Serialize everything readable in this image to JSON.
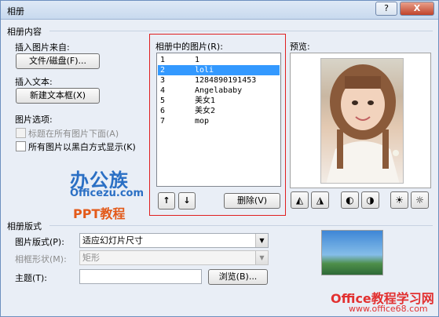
{
  "window": {
    "title": "相册",
    "help_label": "?",
    "close_label": "X"
  },
  "album_content": {
    "group_title": "相册内容",
    "insert_from_label": "插入图片来自:",
    "file_disk_button": "文件/磁盘(F)...",
    "insert_text_label": "插入文本:",
    "new_textbox_button": "新建文本框(X)",
    "picture_options_label": "图片选项:",
    "caption_below_option": "标题在所有图片下面(A)",
    "black_white_option": "所有图片以黑白方式显示(K)"
  },
  "picture_list": {
    "label": "相册中的图片(R):",
    "items": [
      {
        "num": "1",
        "name": "1"
      },
      {
        "num": "2",
        "name": "loli",
        "selected": true
      },
      {
        "num": "3",
        "name": "1284890191453"
      },
      {
        "num": "4",
        "name": "Angelababy"
      },
      {
        "num": "5",
        "name": "美女1"
      },
      {
        "num": "6",
        "name": "美女2"
      },
      {
        "num": "7",
        "name": "mop"
      }
    ],
    "move_up_label": "↑",
    "move_down_label": "↓",
    "delete_button": "删除(V)"
  },
  "preview": {
    "label": "预览:"
  },
  "layout": {
    "group_title": "相册版式",
    "picture_layout_label": "图片版式(P):",
    "picture_layout_value": "适应幻灯片尺寸",
    "frame_shape_label": "相框形状(M):",
    "frame_shape_value": "矩形",
    "theme_label": "主题(T):",
    "theme_value": "",
    "browse_button": "浏览(B)..."
  },
  "watermark": {
    "logo_main": "办公族",
    "logo_site": "Officezu.com",
    "logo_sub": "PPT教程",
    "bottom_main": "Office教程学习网",
    "bottom_site": "www.office68.com"
  }
}
